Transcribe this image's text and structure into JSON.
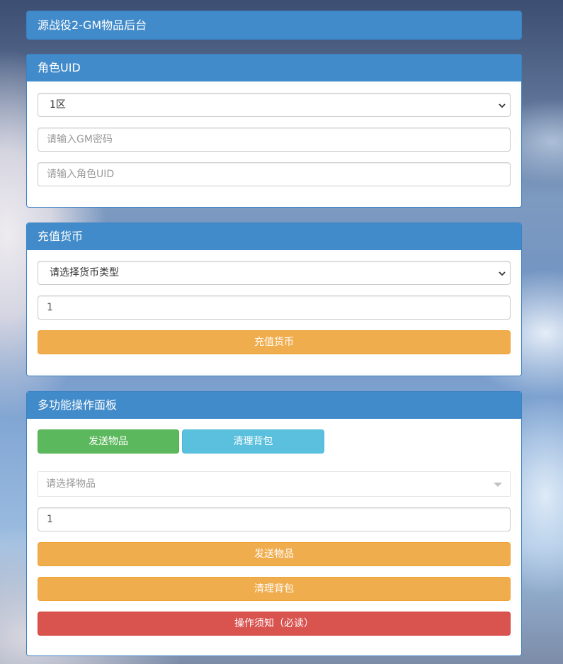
{
  "header": {
    "title": "源战役2-GM物品后台"
  },
  "role_panel": {
    "title": "角色UID",
    "server_select": {
      "value": "1区"
    },
    "gm_password": {
      "placeholder": "请输入GM密码",
      "value": ""
    },
    "role_uid": {
      "placeholder": "请输入角色UID",
      "value": ""
    }
  },
  "recharge_panel": {
    "title": "充值货币",
    "currency_select": {
      "value": "请选择货币类型"
    },
    "amount": {
      "value": "1"
    },
    "submit_label": "充值货币"
  },
  "multi_panel": {
    "title": "多功能操作面板",
    "tabs": [
      {
        "label": "发送物品",
        "color": "#5cb85c"
      },
      {
        "label": "清理背包",
        "color": "#5bc0de"
      }
    ],
    "item_select": {
      "placeholder": "请选择物品"
    },
    "quantity": {
      "value": "1"
    },
    "send_label": "发送物品",
    "clear_label": "清理背包",
    "notice_label": "操作须知（必读）"
  },
  "colors": {
    "panel_header": "#428bca",
    "warning": "#f0ad4e",
    "success": "#5cb85c",
    "info": "#5bc0de",
    "danger": "#d9534f"
  }
}
